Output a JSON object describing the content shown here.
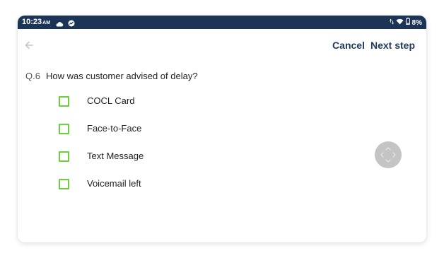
{
  "status_bar": {
    "time": "10:23",
    "ampm": "AM",
    "left_icons": [
      "cloud-icon",
      "app-badge-icon"
    ],
    "right_icons": [
      "data-arrows-icon",
      "wifi-icon",
      "battery-icon"
    ],
    "battery": "8%"
  },
  "header": {
    "back_icon": "back-arrow-icon",
    "cancel_label": "Cancel",
    "next_label": "Next step"
  },
  "question": {
    "number": "Q.6",
    "text": "How was customer advised of delay?"
  },
  "options": [
    {
      "label": "COCL Card"
    },
    {
      "label": "Face-to-Face"
    },
    {
      "label": "Text Message"
    },
    {
      "label": "Voicemail left"
    }
  ],
  "colors": {
    "status_bar": "#1c3557",
    "accent_text": "#1f3a5c",
    "checkbox_border": "#6ccf3c",
    "joystick": "#c4c4c4"
  },
  "floating_control": {
    "icon": "four-way-arrows-icon"
  }
}
